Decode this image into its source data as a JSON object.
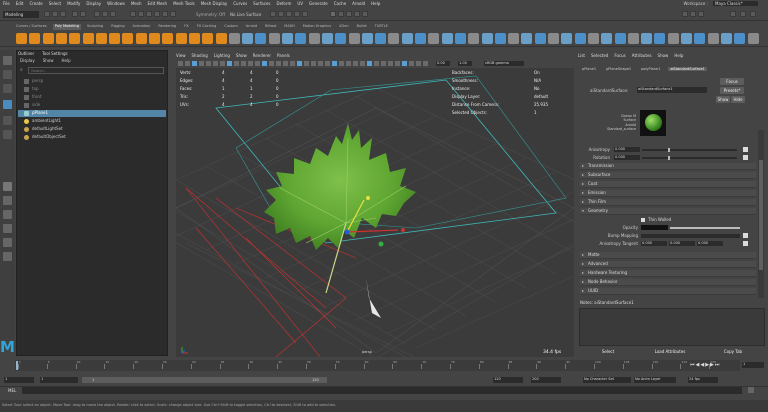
{
  "menubar": {
    "items": [
      "File",
      "Edit",
      "Create",
      "Select",
      "Modify",
      "Display",
      "Windows",
      "Mesh",
      "Edit Mesh",
      "Mesh Tools",
      "Mesh Display",
      "Curves",
      "Surfaces",
      "Deform",
      "UV",
      "Generate",
      "Cache",
      "Arnold",
      "Help"
    ],
    "workspace_label": "Workspace :",
    "workspace_value": "Maya Classic*"
  },
  "statusline": {
    "mode": "Modeling",
    "live_surface": "No Live Surface",
    "symmetry": "Symmetry: Off"
  },
  "shelf": {
    "tabs": [
      "Curves / Surfaces",
      "Poly Modeling",
      "Sculpting",
      "Rigging",
      "Animation",
      "Rendering",
      "FX",
      "FX Caching",
      "Custom",
      "Arnold",
      "Bifrost",
      "MASH",
      "Motion Graphics",
      "XGen",
      "Bullet",
      "TURTLE"
    ],
    "active_tab": "Poly Modeling"
  },
  "outliner": {
    "tabs": [
      "Outliner",
      "Tool Settings"
    ],
    "menu": [
      "Display",
      "Show",
      "Help"
    ],
    "search_placeholder": "Search...",
    "items": [
      {
        "label": "persp",
        "dim": true
      },
      {
        "label": "top",
        "dim": true
      },
      {
        "label": "front",
        "dim": true
      },
      {
        "label": "side",
        "dim": true
      },
      {
        "label": "pPlane1",
        "selected": true
      },
      {
        "label": "ambientLight1"
      },
      {
        "label": "defaultLightSet"
      },
      {
        "label": "defaultObjectSet"
      }
    ]
  },
  "viewport": {
    "menu": [
      "View",
      "Shading",
      "Lighting",
      "Show",
      "Renderer",
      "Panels"
    ],
    "exposure": "0.00",
    "gamma": "1.00",
    "colorspace": "sRGB gamma",
    "camera": "persp",
    "fps": "34.4 fps",
    "hud_left": [
      {
        "label": "Verts:",
        "a": "4",
        "b": "4",
        "c": "0"
      },
      {
        "label": "Edges:",
        "a": "4",
        "b": "4",
        "c": "0"
      },
      {
        "label": "Faces:",
        "a": "1",
        "b": "1",
        "c": "0"
      },
      {
        "label": "Tris:",
        "a": "2",
        "b": "2",
        "c": "0"
      },
      {
        "label": "UVs:",
        "a": "4",
        "b": "4",
        "c": "0"
      }
    ],
    "hud_right": [
      {
        "label": "Backfaces:",
        "value": "On"
      },
      {
        "label": "Smoothness:",
        "value": "N/A"
      },
      {
        "label": "Instance:",
        "value": "No"
      },
      {
        "label": "Display Layer:",
        "value": "default"
      },
      {
        "label": "Distance From Camera:",
        "value": "25.935"
      },
      {
        "label": "Selected Objects:",
        "value": "1"
      }
    ]
  },
  "attribute_editor": {
    "menu": [
      "List",
      "Selected",
      "Focus",
      "Attributes",
      "Show",
      "Help"
    ],
    "node_tabs": [
      "pPlane1",
      "pPlaneShape1",
      "polyPlane1",
      "aiStandardSurface1"
    ],
    "active_node_tab": "aiStandardSurface1",
    "type_label": "aiStandardSurface:",
    "node_name": "aiStandardSurface1",
    "focus_btn": "Focus",
    "presets_btn": "Presets*",
    "show_btn": "Show",
    "hide_btn": "Hide",
    "swatch_caption": [
      "Drawn M",
      "Surface",
      "Arnold",
      "Standard_surface"
    ],
    "anisotropy_label": "Anisotropy",
    "anisotropy_value": "0.000",
    "rotation_label": "Rotation",
    "rotation_value": "0.000",
    "sections_top": [
      "Transmission",
      "Subsurface",
      "Coat",
      "Emission",
      "Thin Film"
    ],
    "geometry_section": "Geometry",
    "thin_walled_label": "Thin Walled",
    "opacity_label": "Opacity",
    "bump_label": "Bump Mapping",
    "aniso_tangent_label": "Anisotropy Tangent",
    "aniso_tangent_values": [
      "0.000",
      "0.000",
      "0.000"
    ],
    "sections_bottom": [
      "Matte",
      "Advanced",
      "Hardware Texturing",
      "Node Behavior",
      "UUID"
    ],
    "notes_label": "Notes: aiStandardSurface1",
    "select_btn": "Select",
    "load_btn": "Load Attributes",
    "copy_btn": "Copy Tab"
  },
  "timeline": {
    "ticks": [
      "1",
      "5",
      "10",
      "15",
      "20",
      "25",
      "30",
      "35",
      "40",
      "45",
      "50",
      "55",
      "60",
      "65",
      "70",
      "75",
      "80",
      "85",
      "90",
      "95",
      "100",
      "105",
      "110",
      "115",
      "120"
    ],
    "current_frame": "1"
  },
  "range": {
    "start": "1",
    "start2": "1",
    "range_start": "1",
    "range_end": "120",
    "end": "120",
    "end2": "200",
    "char_set": "No Character Set",
    "anim_layer": "No Anim Layer",
    "fps": "24 fps"
  },
  "command": {
    "lang": "MEL"
  },
  "help_line": "Select Tool: select an object. Move Tool: drag to move the object. Rotate: click to select. Scale: change object size. Use Ctrl+Shift to toggle selection, Ctrl to deselect, Shift to add to selection."
}
